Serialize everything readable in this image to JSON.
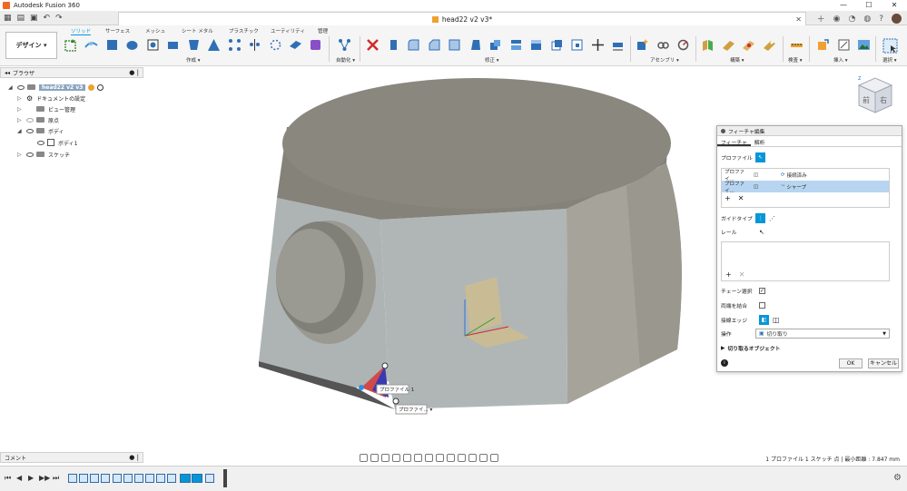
{
  "window": {
    "title": "Autodesk Fusion 360",
    "controls": [
      "—",
      "☐",
      "✕"
    ]
  },
  "document_tab": {
    "label": "head22 v2 v3*"
  },
  "toolbar": {
    "workspace": "デザイン ▾",
    "tabs": [
      "ソリッド",
      "サーフェス",
      "メッシュ",
      "シート メタル",
      "プラスチック",
      "ユーティリティ",
      "管理"
    ],
    "groups": [
      "作成 ▾",
      "自動化 ▾",
      "修正 ▾",
      "アセンブリ ▾",
      "構築 ▾",
      "検査 ▾",
      "挿入 ▾",
      "選択 ▾"
    ]
  },
  "browser": {
    "header": "ブラウザ",
    "items": [
      {
        "label": "head22 v2 v3"
      },
      {
        "label": "ドキュメントの設定"
      },
      {
        "label": "ビュー管理"
      },
      {
        "label": "原点"
      },
      {
        "label": "ボディ"
      },
      {
        "label": "ボディ1"
      },
      {
        "label": "スケッチ"
      }
    ]
  },
  "dialog": {
    "title": "フィーチャ編集",
    "tabs": [
      "フィーチャ",
      "解析"
    ],
    "profile_label": "プロファイル",
    "profile_rows": [
      {
        "name": "プロファイ...",
        "type": "接続済み"
      },
      {
        "name": "プロファイ...",
        "type": "シャープ"
      }
    ],
    "add": "+",
    "remove": "✕",
    "guide_type_label": "ガイドタイプ",
    "rail_label": "レール",
    "chain_select_label": "チェーン選択",
    "chain_select_checked": "✓",
    "merge_ends_label": "両端を結合",
    "tangent_edges_label": "接線エッジ",
    "operation_label": "操作",
    "operation_value": "切り取り",
    "objects_label": "切り取るオブジェクト",
    "ok_label": "OK",
    "cancel_label": "キャンセル"
  },
  "viewport": {
    "tooltip_profile_1": "プロファイル 1",
    "tooltip_profile_select": "プロファイ... ▾",
    "viewcube": {
      "front": "前",
      "right": "右",
      "axis_z": "Z"
    }
  },
  "comments": {
    "label": "コメント"
  },
  "status": {
    "text": "1 プロファイル 1 スケッチ 点 | 最小距離 : 7.847 mm"
  },
  "timeline": {
    "controls": [
      "⏮",
      "◀",
      "▶",
      "▶▶",
      "⏭"
    ]
  }
}
